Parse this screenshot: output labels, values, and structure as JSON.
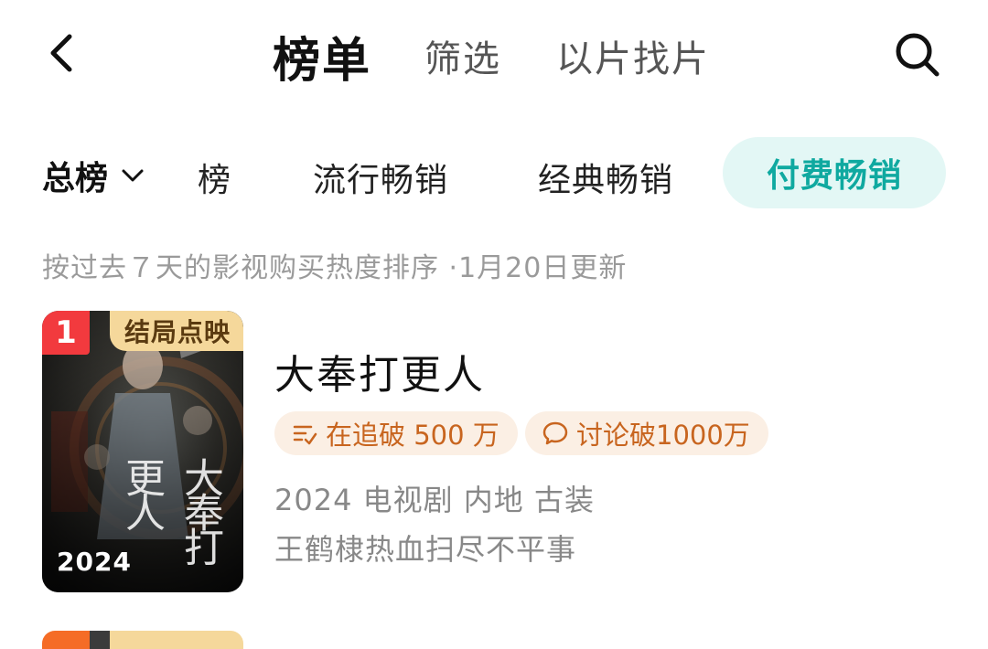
{
  "header": {
    "back_icon": "chevron-left-icon",
    "tabs": [
      {
        "label": "榜单",
        "active": true
      },
      {
        "label": "筛选",
        "active": false
      },
      {
        "label": "以片找片",
        "active": false
      }
    ],
    "search_icon": "search-icon"
  },
  "categories": {
    "dropdown_label": "总榜",
    "dropdown_icon": "chevron-down-icon",
    "items": [
      {
        "label": "榜",
        "active": false
      },
      {
        "label": "流行畅销",
        "active": false
      },
      {
        "label": "经典畅销",
        "active": false
      },
      {
        "label": "付费畅销",
        "active": true
      }
    ],
    "active_color": "#0fa9a0"
  },
  "subtitle": "按过去７天的影视购买热度排序 ·1月20日更新",
  "list": [
    {
      "rank": "1",
      "badge": "结局点映",
      "poster_year": "2024",
      "poster_title_art": "大奉打更人",
      "title": "大奉打更人",
      "tags": [
        {
          "icon": "follow-list-icon",
          "text": "在追破 500 万"
        },
        {
          "icon": "comment-bubble-icon",
          "text": "讨论破1000万"
        }
      ],
      "meta": "2024 电视剧 内地 古装",
      "description": "王鹤棣热血扫尽不平事"
    }
  ],
  "colors": {
    "rank_red": "#f23a3e",
    "badge_gold": "#f5d89b",
    "pill_bg": "#fbefe4",
    "pill_text": "#c8651f"
  }
}
